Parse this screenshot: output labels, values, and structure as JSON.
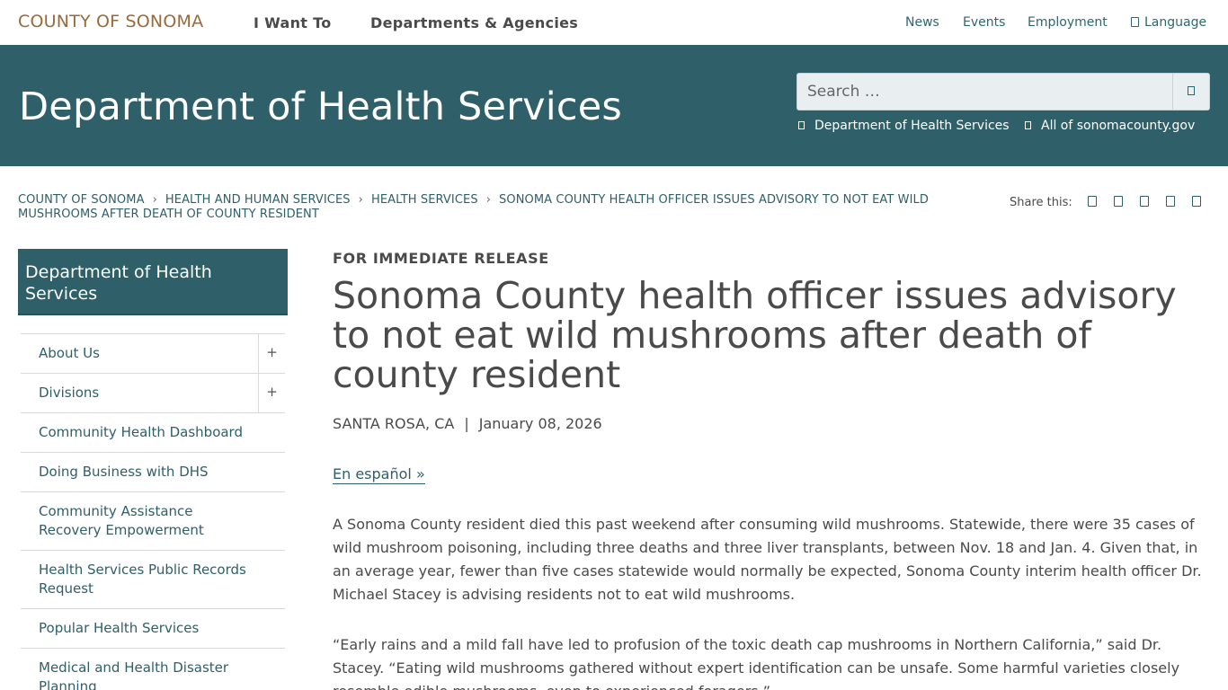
{
  "topnav": {
    "brand": "COUNTY OF SONOMA",
    "main_links": [
      "I Want To",
      "Departments & Agencies"
    ],
    "util_links": [
      "News",
      "Events",
      "Employment"
    ],
    "language": "Language"
  },
  "header": {
    "title": "Department of Health Services",
    "search_placeholder": "Search …",
    "scope_department": "Department of Health Services",
    "scope_all": "All of sonomacounty.gov"
  },
  "breadcrumb": {
    "items": [
      "COUNTY OF SONOMA",
      "HEALTH AND HUMAN SERVICES",
      "HEALTH SERVICES",
      "SONOMA COUNTY HEALTH OFFICER ISSUES ADVISORY TO NOT EAT WILD MUSHROOMS AFTER DEATH OF COUNTY RESIDENT"
    ],
    "separator": "›"
  },
  "share": {
    "label": "Share this:",
    "icons": [
      "facebook-icon",
      "twitter-icon",
      "linkedin-icon",
      "email-icon",
      "print-icon"
    ]
  },
  "sidebar": {
    "heading": "Department of Health Services",
    "items": [
      {
        "label": "About Us",
        "expand": "+"
      },
      {
        "label": "Divisions",
        "expand": "+"
      },
      {
        "label": "Community Health Dashboard"
      },
      {
        "label": "Doing Business with DHS"
      },
      {
        "label": "Community Assistance Recovery Empowerment"
      },
      {
        "label": "Health Services Public Records Request"
      },
      {
        "label": "Popular Health Services"
      },
      {
        "label": "Medical and Health Disaster Planning"
      }
    ]
  },
  "article": {
    "kicker": "FOR IMMEDIATE RELEASE",
    "headline": "Sonoma County health officer issues advisory to not eat wild mushrooms after death of county resident",
    "location": "SANTA ROSA, CA",
    "date_separator": "|",
    "date": "January 08, 2026",
    "spanish_link": "En español »",
    "paragraphs": [
      "A Sonoma County resident died this past weekend after consuming wild mushrooms. Statewide, there were 35 cases of wild mushroom poisoning, including three deaths and three liver transplants, between Nov. 18 and Jan. 4. Given that, in an average year, fewer than five cases statewide would normally be expected, Sonoma County interim health officer Dr. Michael Stacey is advising residents not to eat wild mushrooms.",
      "“Early rains and a mild fall have led to profusion of the toxic death cap mushrooms in Northern California,” said Dr. Stacey. “Eating wild mushrooms gathered without expert identification can be unsafe. Some harmful varieties closely resemble edible mushrooms, even to experienced foragers.”"
    ]
  },
  "colors": {
    "brand": "#9a6a3a",
    "primary": "#2f5f69",
    "text": "#4a4a4a"
  }
}
